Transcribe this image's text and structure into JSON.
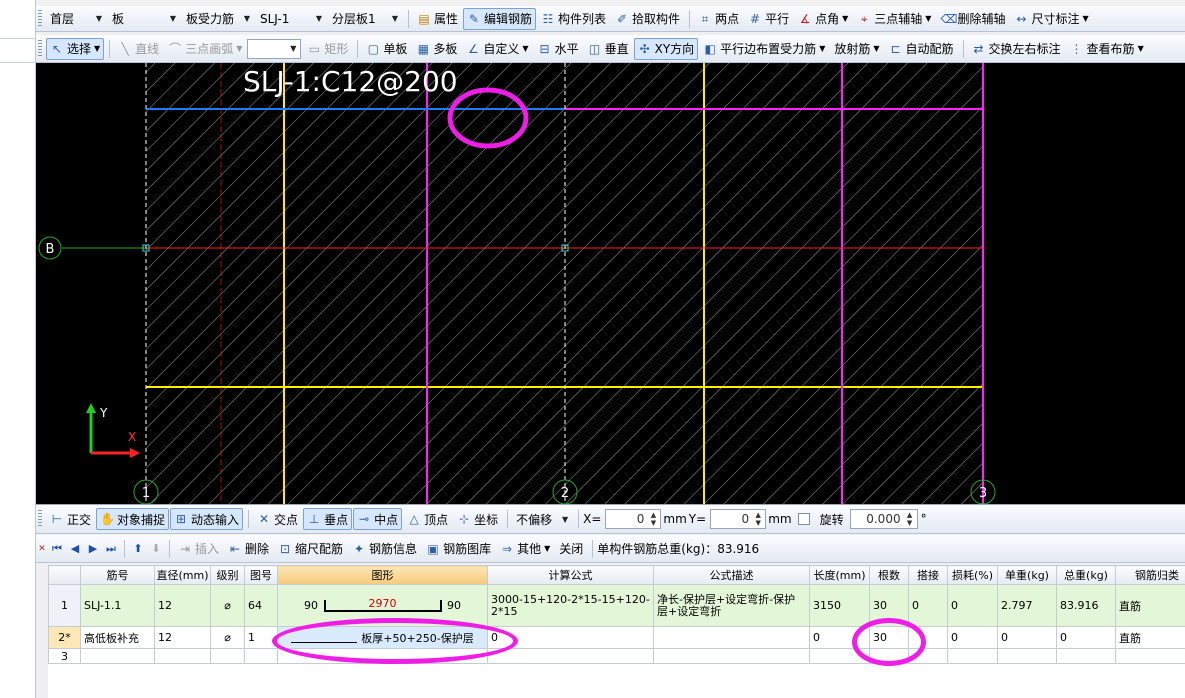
{
  "toolbar1": {
    "floor": "首层",
    "component_type": "板",
    "sub_type": "板受力筋",
    "component": "SLJ-1",
    "layer": "分层板1",
    "buttons": [
      "属性",
      "编辑钢筋",
      "构件列表",
      "拾取构件",
      "两点",
      "平行",
      "点角",
      "三点辅轴",
      "删除辅轴",
      "尺寸标注"
    ]
  },
  "toolbar2": {
    "select": "选择",
    "line": "直线",
    "arc": "三点画弧",
    "rect": "矩形",
    "buttons": [
      "单板",
      "多板",
      "自定义",
      "水平",
      "垂直",
      "XY方向",
      "平行边布置受力筋",
      "放射筋",
      "自动配筋",
      "交换左右标注",
      "查看布筋"
    ]
  },
  "canvas": {
    "rebar_label": "SLJ-1:C12@200",
    "axis_b": "B",
    "axis_1": "1",
    "axis_2": "2",
    "axis_3": "3",
    "ucs_x": "X",
    "ucs_y": "Y",
    "colors": {
      "blue": "#1e7bff",
      "magenta": "#ff22ff",
      "yellow": "#ffee00",
      "red": "#ff2020",
      "green": "#22aa22",
      "hatch": "#9a9a9a",
      "highlight": "#ee1ee6"
    }
  },
  "snapbar": {
    "ortho": "正交",
    "osnap": "对象捕捉",
    "dyn_input": "动态输入",
    "intersect": "交点",
    "perp": "垂点",
    "mid": "中点",
    "vertex": "顶点",
    "coord": "坐标",
    "offset_mode": "不偏移",
    "x_label": "X=",
    "x_value": "0",
    "y_label": "Y=",
    "y_value": "0",
    "unit": "mm",
    "rotate_label": "旋转",
    "rotate_value": "0.000",
    "degree": "°"
  },
  "rebar_toolbar": {
    "insert": "插入",
    "delete": "删除",
    "scale_rebar": "缩尺配筋",
    "rebar_info": "钢筋信息",
    "rebar_lib": "钢筋图库",
    "other": "其他",
    "close": "关闭",
    "total": "单构件钢筋总重(kg)：83.916"
  },
  "table": {
    "headers": [
      "",
      "筋号",
      "直径(mm)",
      "级别",
      "图号",
      "图形",
      "计算公式",
      "公式描述",
      "长度(mm)",
      "根数",
      "搭接",
      "损耗(%)",
      "单重(kg)",
      "总重(kg)",
      "钢筋归类"
    ],
    "rows": [
      {
        "idx": "1",
        "name": "SLJ-1.1",
        "dia": "12",
        "grade": "⌀",
        "fig": "64",
        "shape_left": "90",
        "shape_mid": "2970",
        "shape_right": "90",
        "formula": "3000-15+120-2*15-15+120-2*15",
        "desc": "净长-保护层+设定弯折-保护层+设定弯折",
        "length": "3150",
        "count": "30",
        "lap": "0",
        "loss": "0",
        "unit_w": "2.797",
        "total_w": "83.916",
        "category": "直筋"
      },
      {
        "idx": "2*",
        "name": "高低板补充",
        "dia": "12",
        "grade": "⌀",
        "fig": "1",
        "shape_text": "板厚+50+250-保护层",
        "formula": "0",
        "desc": "",
        "length": "0",
        "count": "30",
        "lap": "",
        "loss": "0",
        "unit_w": "0",
        "total_w": "0",
        "category": "直筋"
      },
      {
        "idx": "3",
        "name": "",
        "dia": "",
        "grade": "",
        "fig": "",
        "formula": "",
        "desc": "",
        "length": "",
        "count": "",
        "lap": "",
        "loss": "",
        "unit_w": "",
        "total_w": "",
        "category": ""
      }
    ]
  }
}
